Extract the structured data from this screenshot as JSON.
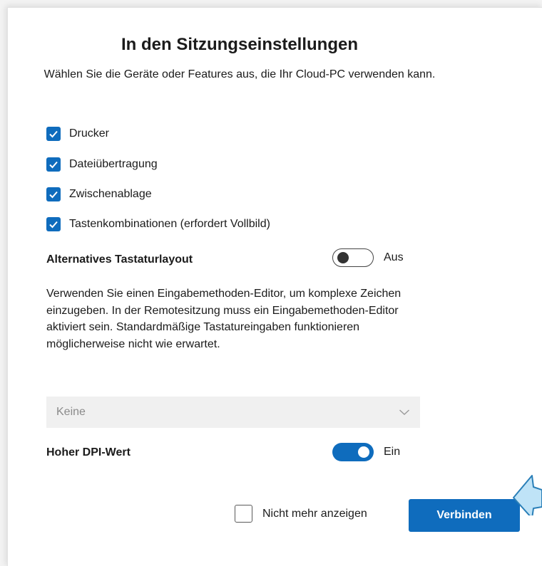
{
  "dialog": {
    "title": "In den Sitzungseinstellungen",
    "subtitle": "Wählen Sie die Geräte oder Features aus, die Ihr Cloud-PC verwenden kann."
  },
  "devices": [
    {
      "label": "Drucker",
      "checked": true
    },
    {
      "label": "Dateiübertragung",
      "checked": true
    },
    {
      "label": "Zwischenablage",
      "checked": true
    },
    {
      "label": "Tastenkombinationen (erfordert Vollbild)",
      "checked": true
    }
  ],
  "keyboard_layout": {
    "label": "Alternatives Tastaturlayout",
    "toggle_state": "Aus",
    "toggle_on": false,
    "description": "Verwenden Sie einen Eingabemethoden-Editor, um komplexe Zeichen einzugeben. In der Remotesitzung muss ein Eingabemethoden-Editor aktiviert sein. Standardmäßige Tastatureingaben funktionieren möglicherweise nicht wie erwartet.",
    "select_value": "Keine"
  },
  "high_dpi": {
    "label": "Hoher DPI-Wert",
    "toggle_state": "Ein",
    "toggle_on": true
  },
  "footer": {
    "dont_show_label": "Nicht mehr anzeigen",
    "dont_show_checked": false,
    "connect_label": "Verbinden"
  },
  "colors": {
    "accent": "#0f6cbd",
    "pointer_fill": "#bfe3f7",
    "pointer_stroke": "#2a7fb8"
  },
  "icons": {
    "checkmark": "checkmark-icon",
    "chevron": "chevron-down-icon",
    "pointer": "arrow-pointer-icon"
  }
}
